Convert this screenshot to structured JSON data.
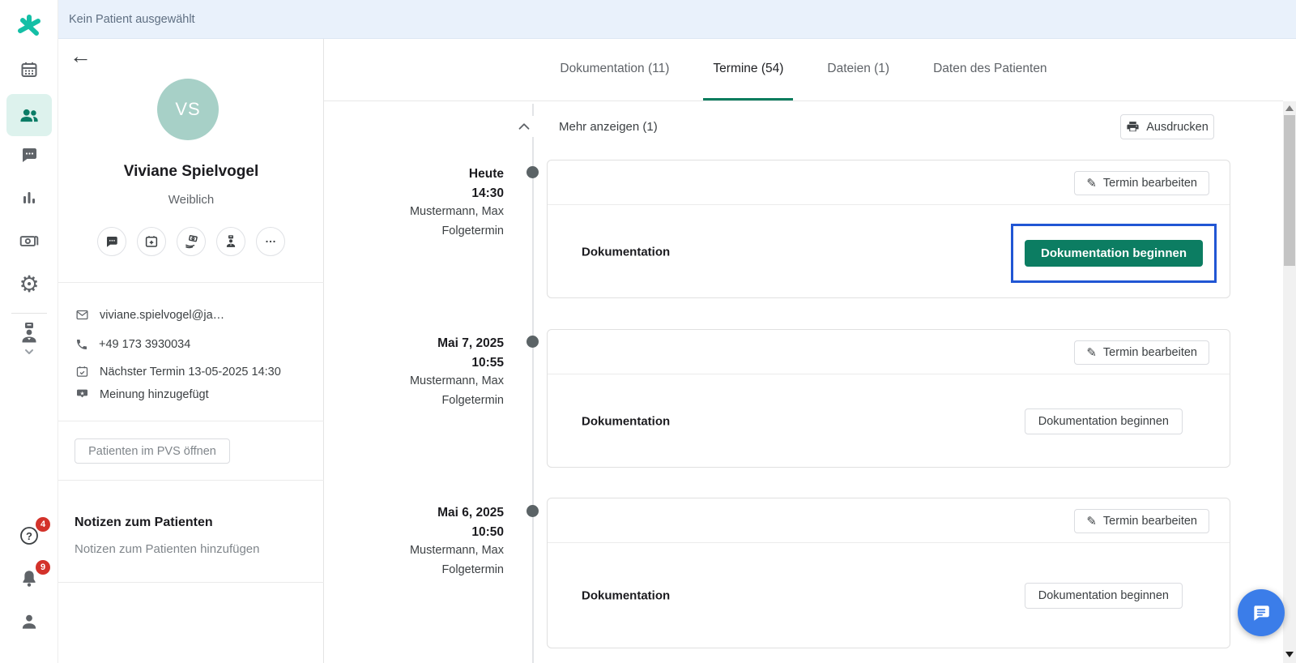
{
  "topbar": {
    "status": "Kein Patient ausgewählt"
  },
  "sidebar": {
    "help_badge": "4",
    "notifications_badge": "9"
  },
  "patient": {
    "initials": "VS",
    "name": "Viviane Spielvogel",
    "gender": "Weiblich",
    "email": "viviane.spielvogel@ja…",
    "phone": "+49 173 3930034",
    "next_appointment": "Nächster Termin 13-05-2025 14:30",
    "review_status": "Meinung hinzugefügt",
    "pvs_button_label": "Patienten im PVS öffnen",
    "notes_title": "Notizen zum Patienten",
    "notes_placeholder": "Notizen zum Patienten hinzufügen"
  },
  "tabs": [
    {
      "label": "Dokumentation (11)",
      "active": false
    },
    {
      "label": "Termine (54)",
      "active": true
    },
    {
      "label": "Dateien (1)",
      "active": false
    },
    {
      "label": "Daten des Patienten",
      "active": false
    }
  ],
  "toolbar": {
    "more_label": "Mehr anzeigen (1)",
    "print_label": "Ausdrucken"
  },
  "appointments": [
    {
      "date": "Heute",
      "time": "14:30",
      "patient": "Mustermann, Max",
      "type": "Folgetermin",
      "edit_label": "Termin bearbeiten",
      "section_label": "Dokumentation",
      "action_label": "Dokumentation beginnen",
      "highlighted": true
    },
    {
      "date": "Mai 7, 2025",
      "time": "10:55",
      "patient": "Mustermann, Max",
      "type": "Folgetermin",
      "edit_label": "Termin bearbeiten",
      "section_label": "Dokumentation",
      "action_label": "Dokumentation beginnen",
      "highlighted": false
    },
    {
      "date": "Mai 6, 2025",
      "time": "10:50",
      "patient": "Mustermann, Max",
      "type": "Folgetermin",
      "edit_label": "Termin bearbeiten",
      "section_label": "Dokumentation",
      "action_label": "Dokumentation beginnen",
      "highlighted": false
    }
  ],
  "colors": {
    "brand_teal": "#14bfa6",
    "active_nav_bg": "#ddf2ed",
    "active_nav_icon": "#0b7c66",
    "primary_green": "#0c7d62",
    "highlight_blue": "#2156d4",
    "badge_red": "#d3322a",
    "fab_blue": "#3b7de9",
    "topbar_bg": "#e9f1fb"
  }
}
